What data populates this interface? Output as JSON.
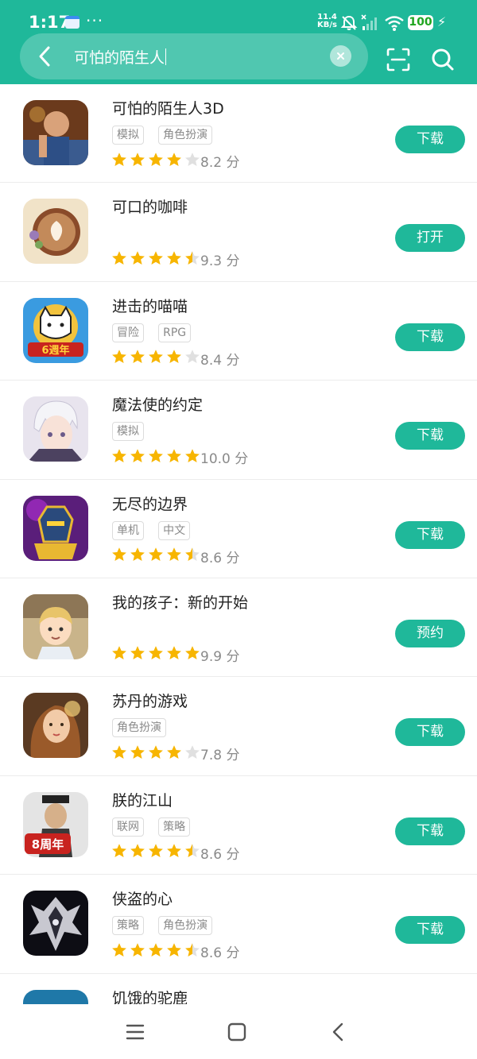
{
  "status": {
    "time": "1:17",
    "more": "···",
    "net_speed_value": "11.4",
    "net_speed_unit": "KB/s",
    "battery": "100"
  },
  "search": {
    "query": "可怕的陌生人"
  },
  "apps": [
    {
      "name": "可怕的陌生人3D",
      "tags": [
        "模拟",
        "角色扮演"
      ],
      "rating": 4.0,
      "score": "8.2 分",
      "action": "下载"
    },
    {
      "name": "可口的咖啡",
      "tags": [],
      "rating": 4.5,
      "score": "9.3 分",
      "action": "打开"
    },
    {
      "name": "进击的喵喵",
      "tags": [
        "冒险",
        "RPG"
      ],
      "rating": 4.0,
      "score": "8.4 分",
      "action": "下载"
    },
    {
      "name": "魔法使的约定",
      "tags": [
        "模拟"
      ],
      "rating": 5.0,
      "score": "10.0 分",
      "action": "下载"
    },
    {
      "name": "无尽的边界",
      "tags": [
        "单机",
        "中文"
      ],
      "rating": 4.5,
      "score": "8.6 分",
      "action": "下载"
    },
    {
      "name": "我的孩子：新的开始",
      "tags": [],
      "rating": 5.0,
      "score": "9.9 分",
      "action": "预约"
    },
    {
      "name": "苏丹的游戏",
      "tags": [
        "角色扮演"
      ],
      "rating": 4.0,
      "score": "7.8 分",
      "action": "下载"
    },
    {
      "name": "朕的江山",
      "tags": [
        "联网",
        "策略"
      ],
      "rating": 4.5,
      "score": "8.6 分",
      "action": "下载"
    },
    {
      "name": "侠盗的心",
      "tags": [
        "策略",
        "角色扮演"
      ],
      "rating": 4.5,
      "score": "8.6 分",
      "action": "下载"
    }
  ],
  "partial_app": {
    "name": "饥饿的驼鹿"
  },
  "icon_labels": {
    "app3_banner": "6週年",
    "app8_banner": "8周年"
  },
  "colors": {
    "accent": "#1fb89a",
    "star": "#f7b500",
    "star_empty": "#e0e0e0"
  }
}
